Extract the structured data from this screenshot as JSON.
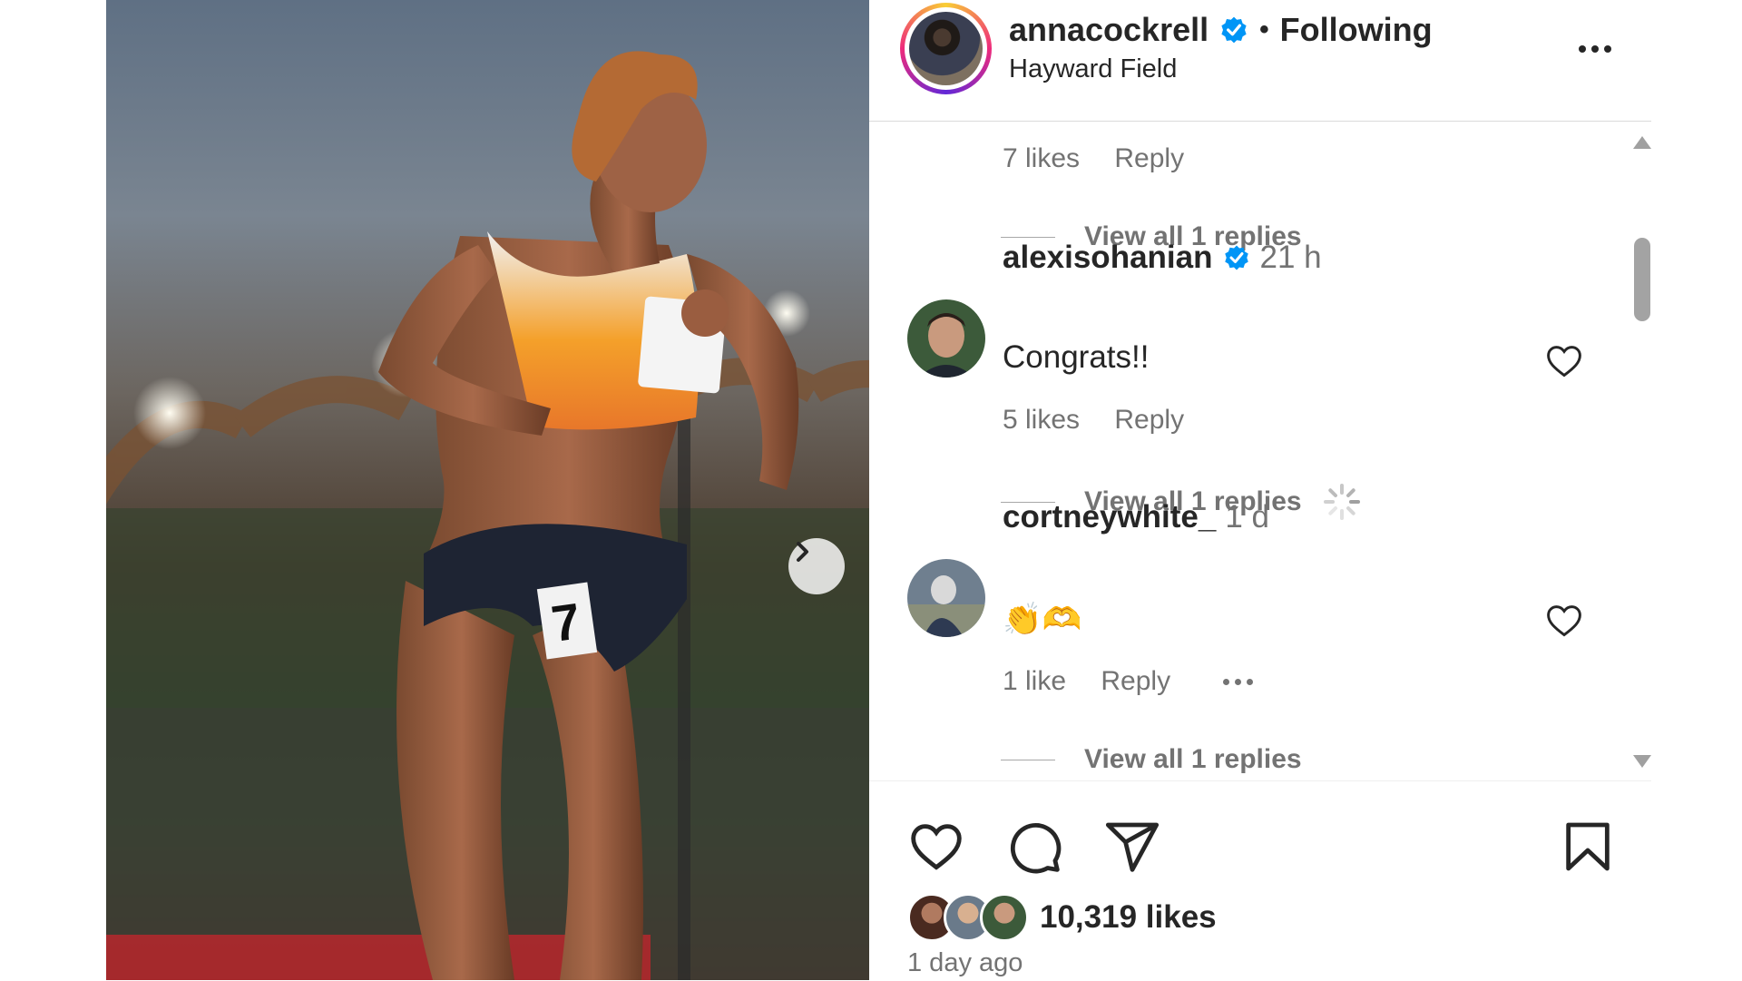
{
  "post": {
    "username": "annacockrell",
    "separator": "•",
    "follow_status": "Following",
    "location": "Hayward Field",
    "photo_bib_number": "7"
  },
  "thread_top": {
    "likes": "7 likes",
    "reply": "Reply",
    "view_replies": "View all 1 replies"
  },
  "comments": [
    {
      "username": "alexisohanian",
      "verified": true,
      "time": "21 h",
      "text": "Congrats!!",
      "likes": "5 likes",
      "reply": "Reply",
      "view_replies": "View all 1 replies"
    },
    {
      "username": "cortneywhite_",
      "verified": false,
      "time": "1 d",
      "text": "👏🫶",
      "likes": "1 like",
      "reply": "Reply",
      "view_replies": "View all 1 replies"
    }
  ],
  "footer": {
    "likes_count": "10,319 likes",
    "time_ago": "1 day ago"
  },
  "icons": {
    "verified": "verified-badge-icon",
    "heart": "heart-icon",
    "comment": "comment-icon",
    "share": "share-icon",
    "bookmark": "bookmark-icon",
    "next": "chevron-right-icon",
    "more": "more-horizontal-icon",
    "loading": "loading-spinner-icon"
  },
  "colors": {
    "verified_blue": "#0095f6",
    "text_primary": "#262626",
    "text_secondary": "#737373",
    "divider": "#dbdbdb"
  }
}
